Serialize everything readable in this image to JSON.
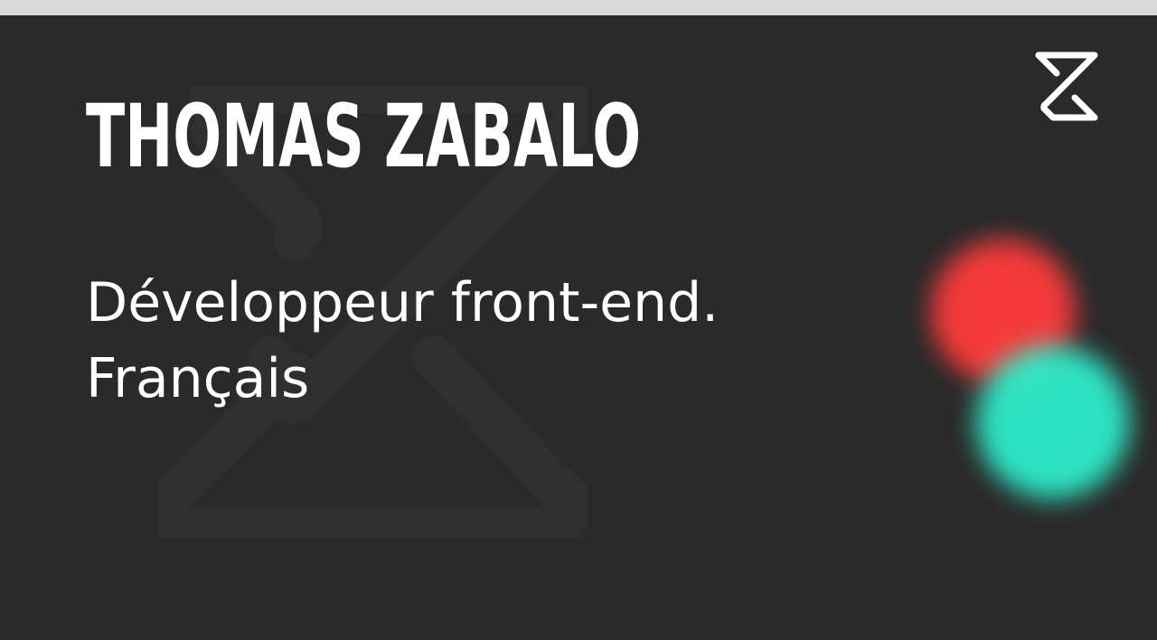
{
  "header": {
    "name": "THOMAS ZABALO",
    "subtitle_line1": "Développeur front-end.",
    "subtitle_line2": "Français"
  },
  "icons": {
    "logo": "z-hourglass-logo",
    "watermark": "z-hourglass-watermark"
  },
  "colors": {
    "background": "#2a2a2a",
    "text": "#ffffff",
    "blob_red": "#ff3b3b",
    "blob_teal": "#2ef2cf"
  }
}
